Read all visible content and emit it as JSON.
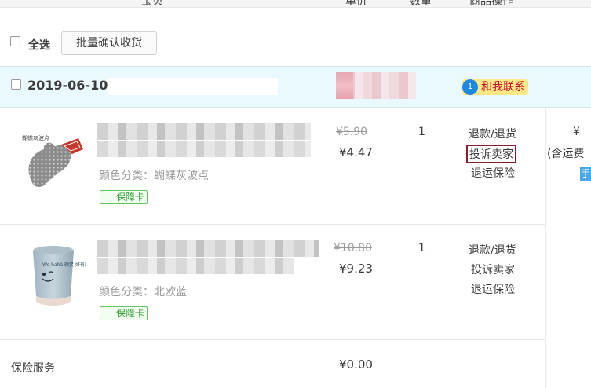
{
  "header": {
    "col_item": "宝贝",
    "col_price": "单价",
    "col_qty": "数量",
    "col_after_sale": "商品操作"
  },
  "toolbar": {
    "select_all_label": "全选",
    "batch_confirm_label": "批量确认收货"
  },
  "order": {
    "date": "2019-06-10",
    "contact_label": "和我联系",
    "contact_icon_num": "1",
    "side_price_symbol": "¥",
    "side_shipping_note": "(含运费",
    "side_button_label": "手"
  },
  "items": [
    {
      "image_label": "蝴蝶灰波点",
      "spec": "颜色分类：蝴蝶灰波点",
      "badge": "保障卡",
      "price_old": "¥5.90",
      "price_new": "¥4.47",
      "qty": "1",
      "actions": [
        "退款/退货",
        "投诉卖家",
        "退运保险"
      ]
    },
    {
      "image_label": "We hahà 微笑 好有趣的",
      "spec": "颜色分类：北欧蓝",
      "badge": "保障卡",
      "price_old": "¥10.80",
      "price_new": "¥9.23",
      "qty": "1",
      "actions": [
        "退款/退货",
        "投诉卖家",
        "退运保险"
      ]
    }
  ],
  "insurance": {
    "label": "保险服务",
    "price": "¥0.00"
  },
  "colors": {
    "accent_red": "#c8102e",
    "order_head_bg": "#eaf8ff",
    "badge_green": "#2f9a35",
    "highlight_border": "#8b1e2a"
  }
}
